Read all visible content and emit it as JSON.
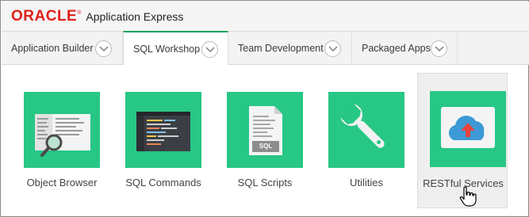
{
  "header": {
    "brand": "ORACLE",
    "brand_mark": "®",
    "product": "Application Express"
  },
  "tabs": [
    {
      "label": "Application Builder",
      "icon": "chevron-down-icon",
      "active": false
    },
    {
      "label": "SQL Workshop",
      "icon": "chevron-down-icon",
      "active": true
    },
    {
      "label": "Team Development",
      "icon": "chevron-down-icon",
      "active": false
    },
    {
      "label": "Packaged Apps",
      "icon": "chevron-down-icon",
      "active": false
    }
  ],
  "tiles": [
    {
      "label": "Object Browser",
      "icon": "object-browser-icon"
    },
    {
      "label": "SQL Commands",
      "icon": "sql-commands-icon"
    },
    {
      "label": "SQL Scripts",
      "icon": "sql-scripts-icon",
      "badge": "SQL"
    },
    {
      "label": "Utilities",
      "icon": "wrench-icon"
    },
    {
      "label": "RESTful Services",
      "icon": "cloud-upload-icon"
    }
  ],
  "colors": {
    "brand_red": "#e0201b",
    "tile_green": "#27c785",
    "active_tab_accent": "#1fa35b",
    "cloud_blue": "#3d9ad6",
    "arrow_red": "#e8453c"
  },
  "cursor": "hand-pointer-icon"
}
